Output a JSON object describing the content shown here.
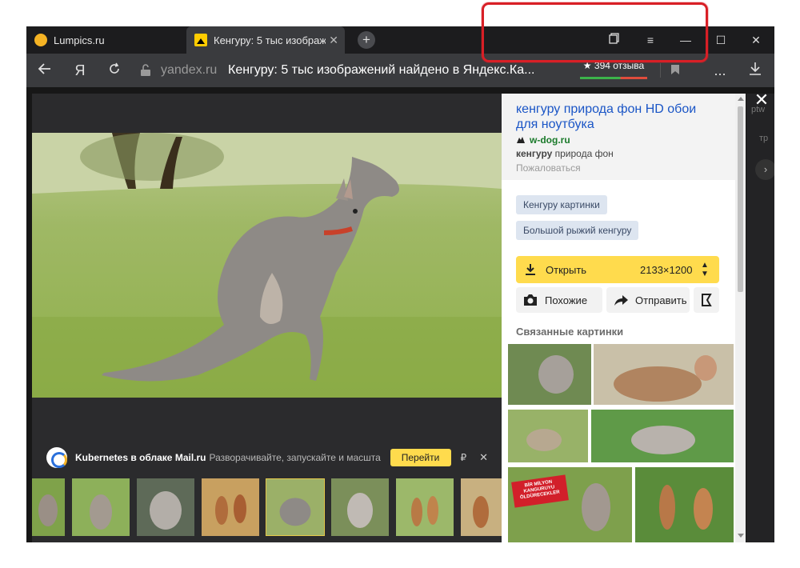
{
  "tabs": [
    {
      "title": "Lumpics.ru"
    },
    {
      "title": "Кенгуру: 5 тыс изображ"
    }
  ],
  "new_tab": "+",
  "window_controls": {
    "menu": "≡",
    "minimize": "—",
    "maximize": "☐",
    "close": "✕"
  },
  "navbar": {
    "yandex_button": "Я",
    "domain": "yandex.ru",
    "page_title": "Кенгуру: 5 тыс изображений найдено в Яндекс.Ка...",
    "reviews": "★ 394 отзыва",
    "more": "..."
  },
  "ad": {
    "title": "Kubernetes в облаке Mail.ru",
    "text": "Разворачивайте, запускайте и масштабируйте",
    "button": "Перейти",
    "currency": "₽",
    "close": "✕"
  },
  "result": {
    "title": "кенгуру природа фон HD обои для ноутбука",
    "source": "w-dog.ru",
    "snippet_bold": "кенгуру",
    "snippet": " природа фон",
    "report": "Пожаловаться"
  },
  "tags": [
    "Кенгуру картинки",
    "Большой рыжий кенгуру"
  ],
  "actions": {
    "open": "Открыть",
    "size": "2133×1200",
    "similar": "Похожие",
    "share": "Отправить"
  },
  "related_title": "Связанные картинки",
  "related_banner": "BİR MİLYON KANGURUYU ÖLDÜRECEKLER",
  "behind_fragments": [
    "ptw",
    "тр"
  ],
  "colors": {
    "accent_yellow": "#ffdb4d",
    "link_blue": "#1a55c6",
    "source_green": "#1a7a2a",
    "highlight_red": "#d81f26"
  }
}
